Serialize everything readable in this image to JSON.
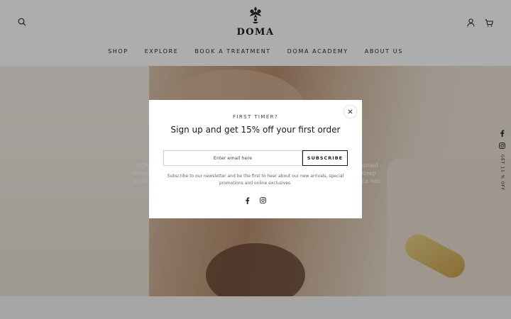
{
  "brand": {
    "name": "DOMA"
  },
  "nav": {
    "items": [
      {
        "label": "SHOP"
      },
      {
        "label": "EXPLORE"
      },
      {
        "label": "BOOK A TREATMENT"
      },
      {
        "label": "DOMA ACADEMY"
      },
      {
        "label": "ABOUT US"
      }
    ]
  },
  "hero": {
    "left_fragments": [
      "DOM",
      "among",
      "sculpt"
    ],
    "right_fragments": [
      "amed",
      "deep",
      "ce has"
    ]
  },
  "side": {
    "promo_text": "GET 15 % OFF"
  },
  "popup": {
    "eyebrow": "FIRST TIMER?",
    "headline": "Sign up and get 15% off your first order",
    "email_placeholder": "Enter email here",
    "subscribe_label": "SUBSCRIBE",
    "description": "Subscribe to our newsletter and be the first to hear about our new arrivals, special promotions and online exclusives."
  },
  "icons": {
    "search": "search-icon",
    "account": "user-icon",
    "cart": "cart-icon",
    "close": "close-icon",
    "facebook": "facebook-icon",
    "instagram": "instagram-icon"
  }
}
